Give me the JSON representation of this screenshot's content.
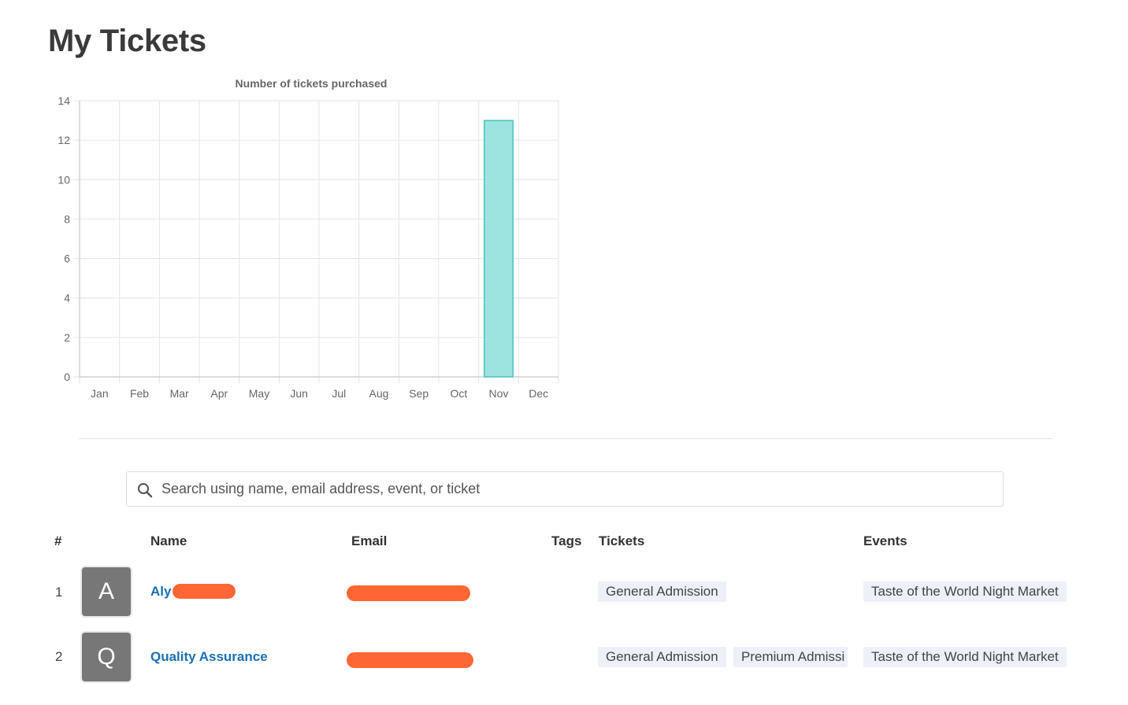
{
  "page": {
    "title": "My Tickets"
  },
  "chart_data": {
    "type": "bar",
    "title": "Number of tickets purchased",
    "categories": [
      "Jan",
      "Feb",
      "Mar",
      "Apr",
      "May",
      "Jun",
      "Jul",
      "Aug",
      "Sep",
      "Oct",
      "Nov",
      "Dec"
    ],
    "values": [
      0,
      0,
      0,
      0,
      0,
      0,
      0,
      0,
      0,
      0,
      13,
      0
    ],
    "ylim": [
      0,
      14
    ],
    "yticks": [
      0,
      2,
      4,
      6,
      8,
      10,
      12,
      14
    ],
    "grid": true,
    "legend": "none",
    "bar_fill": "#9de3e0",
    "bar_stroke": "#2cb8b0"
  },
  "search": {
    "placeholder": "Search using name, email address, event, or ticket",
    "icon": "search-icon"
  },
  "table": {
    "headers": {
      "index": "#",
      "name": "Name",
      "email": "Email",
      "tags": "Tags",
      "tickets": "Tickets",
      "events": "Events"
    },
    "rows": [
      {
        "index": "1",
        "avatar": "A",
        "name": "Aly",
        "tickets": [
          "General Admission"
        ],
        "events": [
          "Taste of the World Night Market"
        ]
      },
      {
        "index": "2",
        "avatar": "Q",
        "name": "Quality Assurance",
        "tickets": [
          "General Admission",
          "Premium Admissi"
        ],
        "events": [
          "Taste of the World Night Market"
        ]
      }
    ]
  },
  "colors": {
    "link": "#1a6fb5",
    "redaction": "#ff6633",
    "tag_bg": "#edf0f9",
    "avatar_bg": "#777777"
  }
}
